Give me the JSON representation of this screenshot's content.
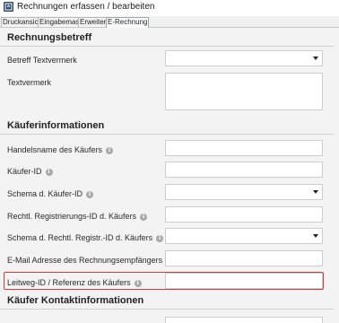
{
  "window": {
    "title": "Rechnungen erfassen / bearbeiten"
  },
  "tabs": [
    {
      "label": "Druckansicht",
      "active": false
    },
    {
      "label": "Eingabemaske",
      "active": false
    },
    {
      "label": "Erweitert",
      "active": false
    },
    {
      "label": "E-Rechnung",
      "active": true
    }
  ],
  "sections": {
    "rechnungsbetreff": {
      "title": "Rechnungsbetreff",
      "fields": [
        {
          "label": "Betreff Textvermerk",
          "type": "select",
          "value": ""
        },
        {
          "label": "Textvermerk",
          "type": "textarea",
          "value": ""
        }
      ]
    },
    "kaeufer": {
      "title": "Käuferinformationen",
      "fields": [
        {
          "label": "Handelsname des Käufers",
          "type": "text",
          "value": "",
          "info": true
        },
        {
          "label": "Käufer-ID",
          "type": "text",
          "value": "",
          "info": true
        },
        {
          "label": "Schema d. Käufer-ID",
          "type": "select",
          "value": "",
          "info": true
        },
        {
          "label": "Rechtl. Registrierungs-ID d. Käufers",
          "type": "text",
          "value": "",
          "info": true
        },
        {
          "label": "Schema d. Rechtl. Registr.-ID d. Käufers",
          "type": "select",
          "value": "",
          "info": true
        },
        {
          "label": "E-Mail Adresse des Rechnungsempfängers",
          "type": "text",
          "value": "",
          "info": true
        },
        {
          "label": "Leitweg-ID / Referenz des Käufers",
          "type": "text",
          "value": "",
          "info": true,
          "highlighted": true
        }
      ]
    },
    "kontakt": {
      "title": "Käufer Kontaktinformationen"
    }
  },
  "colors": {
    "highlight": "#d63a3a",
    "panel": "#f3f3f3",
    "info_icon": "#a9a9a9"
  },
  "icons": {
    "info": "info-icon",
    "dropdown": "chevron-down-icon"
  }
}
